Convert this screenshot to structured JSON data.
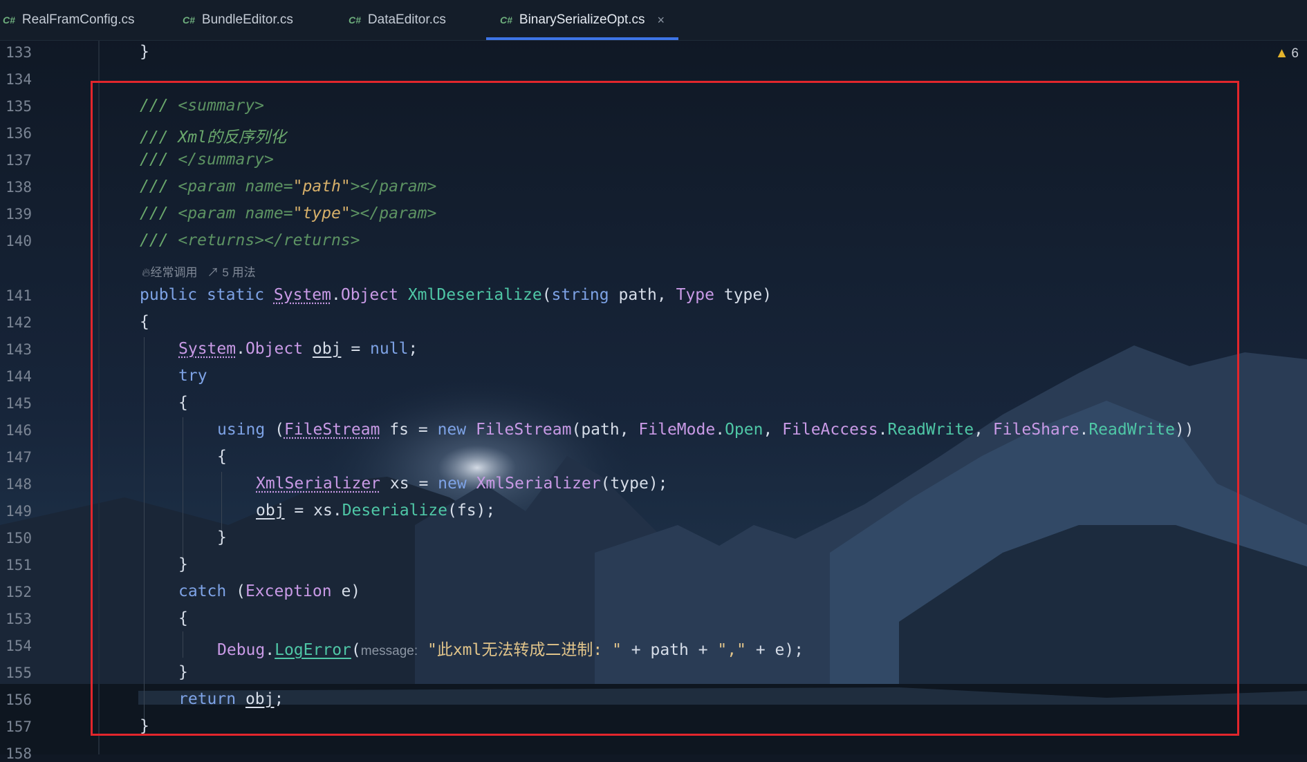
{
  "tabs": [
    {
      "icon": "C#",
      "label": "RealFramConfig.cs"
    },
    {
      "icon": "C#",
      "label": "BundleEditor.cs"
    },
    {
      "icon": "C#",
      "label": "DataEditor.cs"
    },
    {
      "icon": "C#",
      "label": "BinarySerializeOpt.cs",
      "active": true,
      "close": "×"
    }
  ],
  "warning": {
    "icon": "warning-triangle-icon",
    "count": "6"
  },
  "hints": {
    "frequent": "经常调用",
    "usages": "5 用法"
  },
  "line_numbers": [
    "133",
    "134",
    "135",
    "136",
    "137",
    "138",
    "139",
    "140",
    "141",
    "142",
    "143",
    "144",
    "145",
    "146",
    "147",
    "148",
    "149",
    "150",
    "151",
    "152",
    "153",
    "154",
    "155",
    "156",
    "157",
    "158"
  ],
  "code": {
    "l133": "}",
    "doc_prefix": "///",
    "summary_open": "<summary>",
    "doc_desc": "Xml的反序列化",
    "summary_close": "</summary>",
    "param_open": "<param",
    "param_name_attr": "name=",
    "param_path": "\"path\"",
    "param_type": "\"type\"",
    "param_close": "></param>",
    "returns": "<returns></returns>",
    "kw_public": "public",
    "kw_static": "static",
    "type_system": "System",
    "type_object": "Object",
    "method_name": "XmlDeserialize",
    "kw_string": "string",
    "param_list": "path,",
    "type_Type": "Type",
    "param_type_close": "type)",
    "open_brace": "{",
    "close_brace": "}",
    "var_obj": "obj",
    "assign": "=",
    "kw_null": "null",
    "kw_try": "try",
    "kw_using": "using",
    "type_filestream": "FileStream",
    "var_fs": "fs",
    "kw_new": "new",
    "args_path": "(path,",
    "type_filemode": "FileMode",
    "mem_open": "Open",
    "type_fileaccess": "FileAccess",
    "mem_readwrite": "ReadWrite",
    "type_fileshare": "FileShare",
    "type_xmlserializer": "XmlSerializer",
    "var_xs": "xs",
    "args_type": "(type);",
    "mem_deserialize": "Deserialize",
    "args_fs": "(fs);",
    "kw_catch": "catch",
    "type_exception": "Exception",
    "var_e": "e)",
    "type_debug": "Debug",
    "fn_logerror": "LogError",
    "param_hint_message": "message:",
    "str_error": "\"此xml无法转成二进制: \"",
    "concat_rest": "+ path +",
    "str_comma": "\",\"",
    "concat_end": "+ e);",
    "kw_return": "return"
  },
  "colors": {
    "highlight_box": "#e2262c",
    "active_tab_underline": "#3d74e6"
  }
}
